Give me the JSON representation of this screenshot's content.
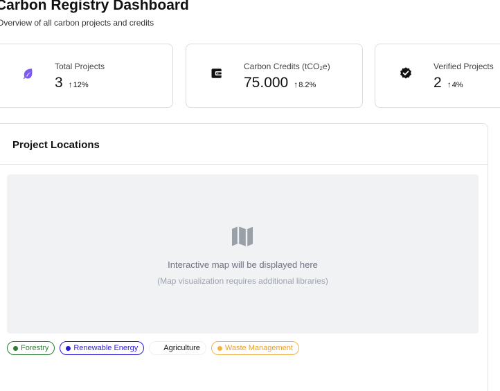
{
  "header": {
    "title": "Carbon Registry Dashboard",
    "subtitle": "Overview of all carbon projects and credits"
  },
  "stats": [
    {
      "label": "Total Projects",
      "value": "3",
      "change": "12%",
      "icon": "leaf-icon",
      "color": "#7c5cf0"
    },
    {
      "label": "Carbon Credits (tCO₂e)",
      "value": "75.000",
      "change": "8.2%",
      "icon": "wallet-icon",
      "color": "#111111"
    },
    {
      "label": "Verified Projects",
      "value": "2",
      "change": "4%",
      "icon": "verified-badge-icon",
      "color": "#111111"
    }
  ],
  "locations": {
    "title": "Project Locations",
    "map_placeholder": "Interactive map will be displayed here",
    "map_note": "(Map visualization requires additional libraries)",
    "map_icon": "map-icon",
    "legend": [
      {
        "label": "Forestry",
        "color": "#2e7d32"
      },
      {
        "label": "Renewable Energy",
        "color": "#2b1bd6"
      },
      {
        "label": "Agriculture",
        "color": "#ffffff"
      },
      {
        "label": "Waste Management",
        "color": "#f2b34a"
      }
    ]
  }
}
